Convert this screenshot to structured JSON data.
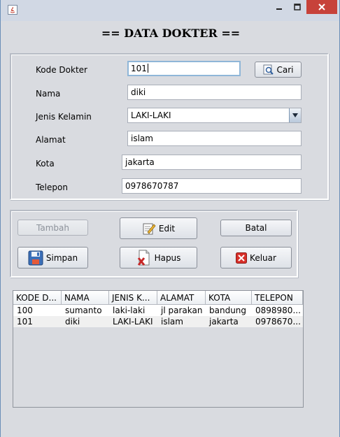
{
  "window": {
    "title": ""
  },
  "header": {
    "title": "== DATA DOKTER =="
  },
  "form": {
    "kode_label": "Kode Dokter",
    "kode_value": "101",
    "nama_label": "Nama",
    "nama_value": "diki",
    "jenis_label": "Jenis Kelamin",
    "jenis_value": "LAKI-LAKI",
    "alamat_label": "Alamat",
    "alamat_value": "islam",
    "kota_label": "Kota",
    "kota_value": "jakarta",
    "telepon_label": "Telepon",
    "telepon_value": "0978670787",
    "cari_label": "Cari"
  },
  "buttons": {
    "tambah": "Tambah",
    "edit": "Edit",
    "batal": "Batal",
    "simpan": "Simpan",
    "hapus": "Hapus",
    "keluar": "Keluar"
  },
  "table": {
    "headers": [
      "KODE D...",
      "NAMA",
      "JENIS K...",
      "ALAMAT",
      "KOTA",
      "TELEPON"
    ],
    "rows": [
      [
        "100",
        "sumanto",
        "laki-laki",
        "jl parakan",
        "bandung",
        "0898980..."
      ],
      [
        "101",
        "diki",
        "LAKI-LAKI",
        "islam",
        "jakarta",
        "0978670..."
      ]
    ]
  },
  "colors": {
    "accent": "#c7423a",
    "focus": "#8fb6d8"
  }
}
